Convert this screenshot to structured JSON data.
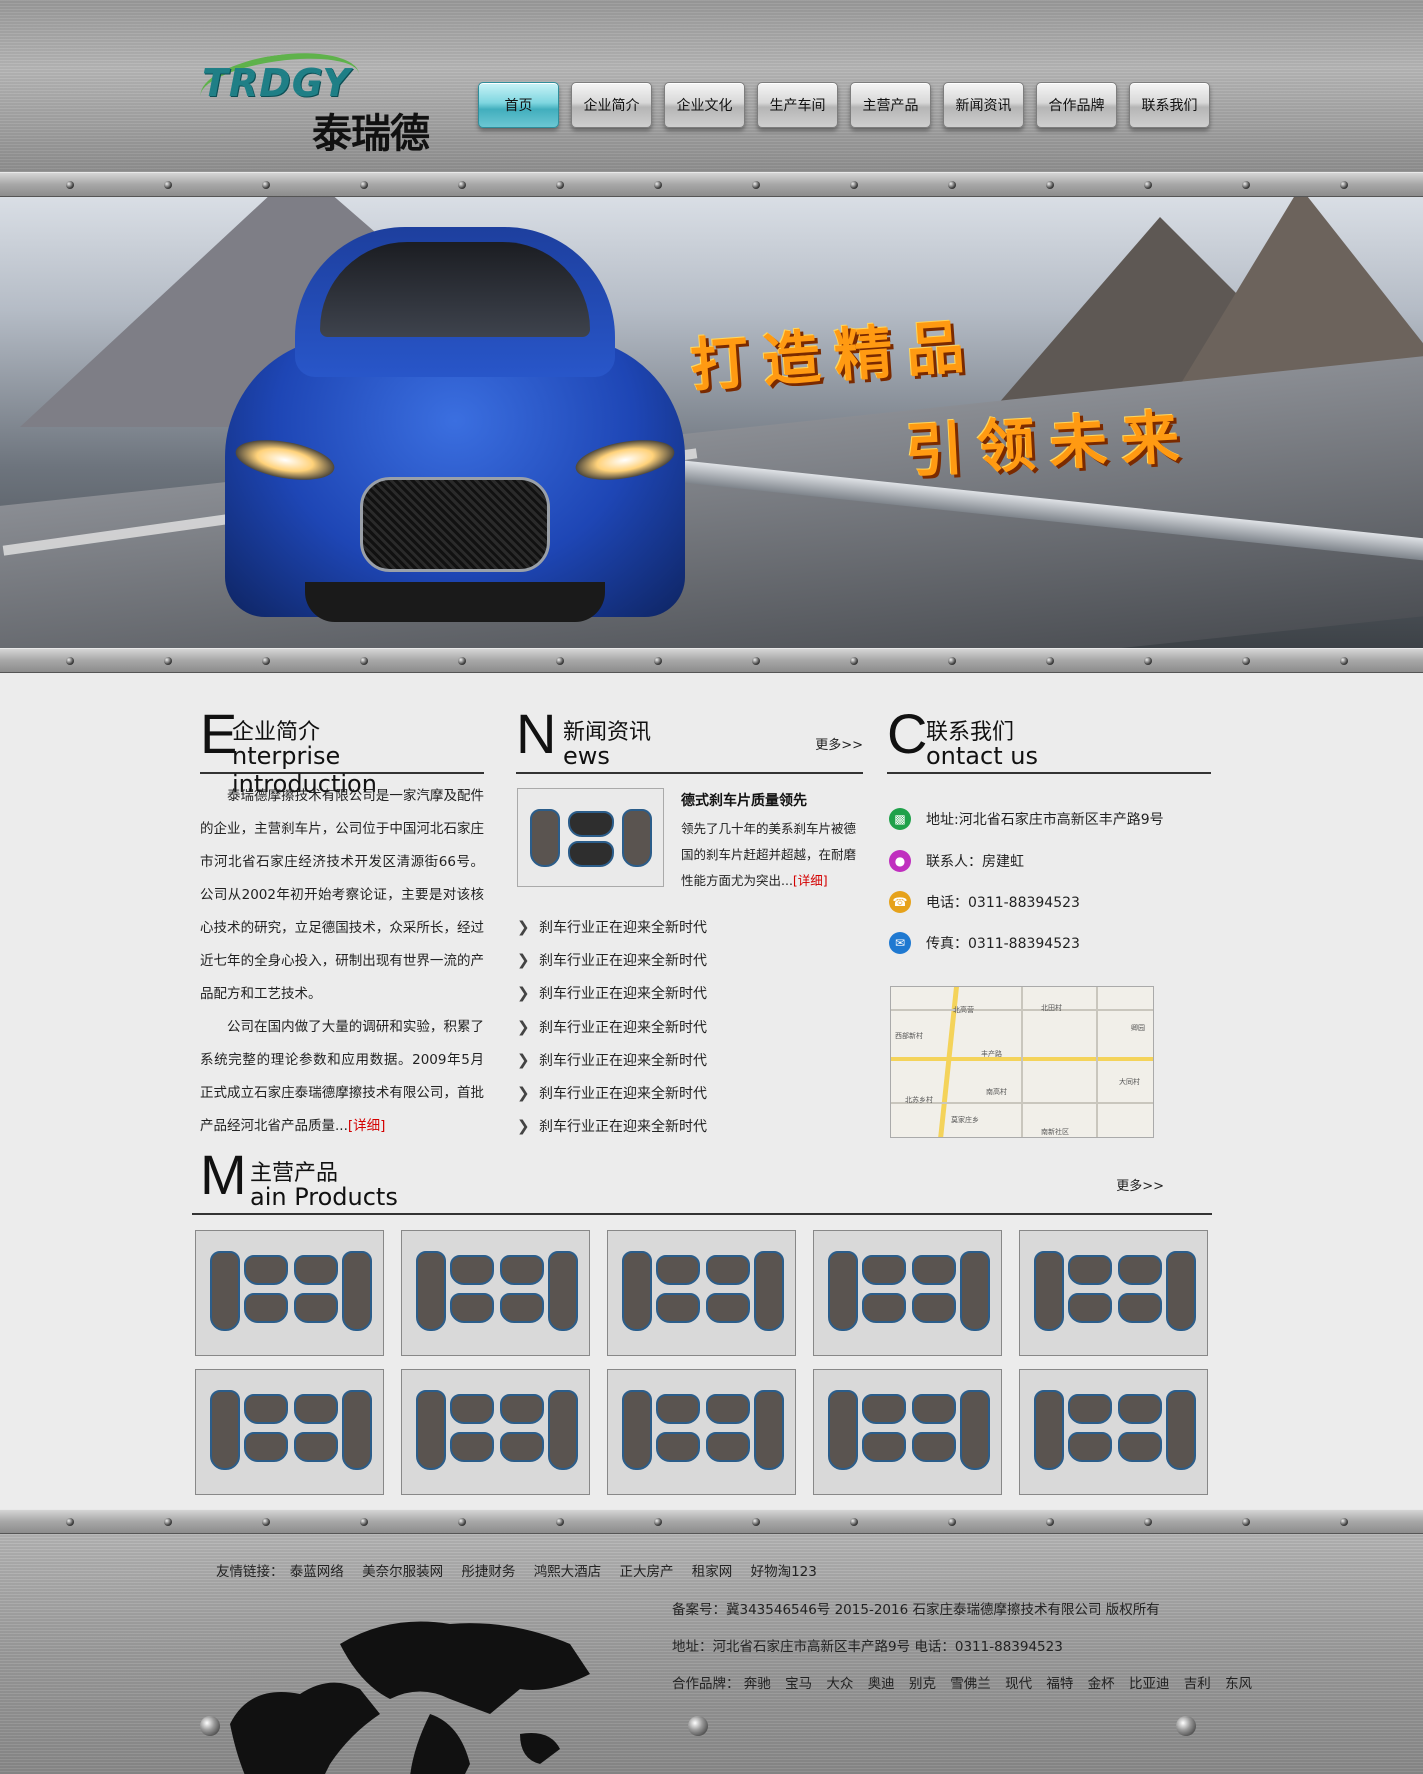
{
  "header": {
    "logo_en": "TRDGY",
    "logo_cn": "泰瑞德",
    "nav": [
      "首页",
      "企业简介",
      "企业文化",
      "生产车间",
      "主营产品",
      "新闻资讯",
      "合作品牌",
      "联系我们"
    ],
    "active_nav": 0
  },
  "banner": {
    "slogan_line1": "打造精品",
    "slogan_line2": "引领未来"
  },
  "intro": {
    "big_letter": "E",
    "title_cn": "企业简介",
    "title_en": "nterprise introduction",
    "para1": "泰瑞德摩擦技术有限公司是一家汽摩及配件的企业，主营刹车片，公司位于中国河北石家庄市河北省石家庄经济技术开发区清源街66号。     公司从2002年初开始考察论证，主要是对该核心技术的研究，立足德国技术，众采所长，经过近七年的全身心投入，研制出现有世界一流的产品配方和工艺技术。",
    "para2": "公司在国内做了大量的调研和实验，积累了系统完整的理论参数和应用数据。2009年5月正式成立石家庄泰瑞德摩擦技术有限公司，首批产品经河北省产品质量...",
    "detail": "[详细]"
  },
  "news": {
    "big_letter": "N",
    "title_cn": "新闻资讯",
    "title_en": "ews",
    "more": "更多>>",
    "headline_title": "德式刹车片质量领先",
    "headline_desc": "领先了几十年的美系刹车片被德国的刹车片赶超并超越，在耐磨性能方面尤为突出...",
    "headline_detail": "[详细]",
    "items": [
      "刹车行业正在迎来全新时代",
      "刹车行业正在迎来全新时代",
      "刹车行业正在迎来全新时代",
      "刹车行业正在迎来全新时代",
      "刹车行业正在迎来全新时代",
      "刹车行业正在迎来全新时代",
      "刹车行业正在迎来全新时代"
    ]
  },
  "contact": {
    "big_letter": "C",
    "title_cn": "联系我们",
    "title_en": "ontact us",
    "address": "地址:河北省石家庄市高新区丰产路9号",
    "person": "联系人：房建虹",
    "phone": "电话：0311-88394523",
    "fax": "传真：0311-88394523",
    "icon_colors": [
      "#1fa14a",
      "#c02fbf",
      "#e6a21b",
      "#1f79d1"
    ],
    "map_labels": [
      "北高营",
      "丰产路",
      "南高村",
      "北苏乡村",
      "莫家庄乡",
      "南新社区",
      "北田村",
      "大同村",
      "卿园",
      "西部新村"
    ]
  },
  "products": {
    "big_letter": "M",
    "title_cn": "主营产品",
    "title_en": "ain Products",
    "more": "更多>>",
    "count": 10
  },
  "footer": {
    "links_label": "友情链接：",
    "links": [
      "泰蓝网络",
      "美奈尔服装网",
      "彤捷财务",
      "鸿熙大酒店",
      "正大房产",
      "租家网",
      "好物淘123"
    ],
    "record": "备案号：冀343546546号    2015-2016  石家庄泰瑞德摩擦技术有限公司  版权所有",
    "address": "地址：河北省石家庄市高新区丰产路9号    电话：0311-88394523",
    "brands_label": "合作品牌：",
    "brands": [
      "奔驰",
      "宝马",
      "大众",
      "奥迪",
      "别克",
      "雪佛兰",
      "现代",
      "福特",
      "金杯",
      "比亚迪",
      "吉利",
      "东风"
    ]
  }
}
